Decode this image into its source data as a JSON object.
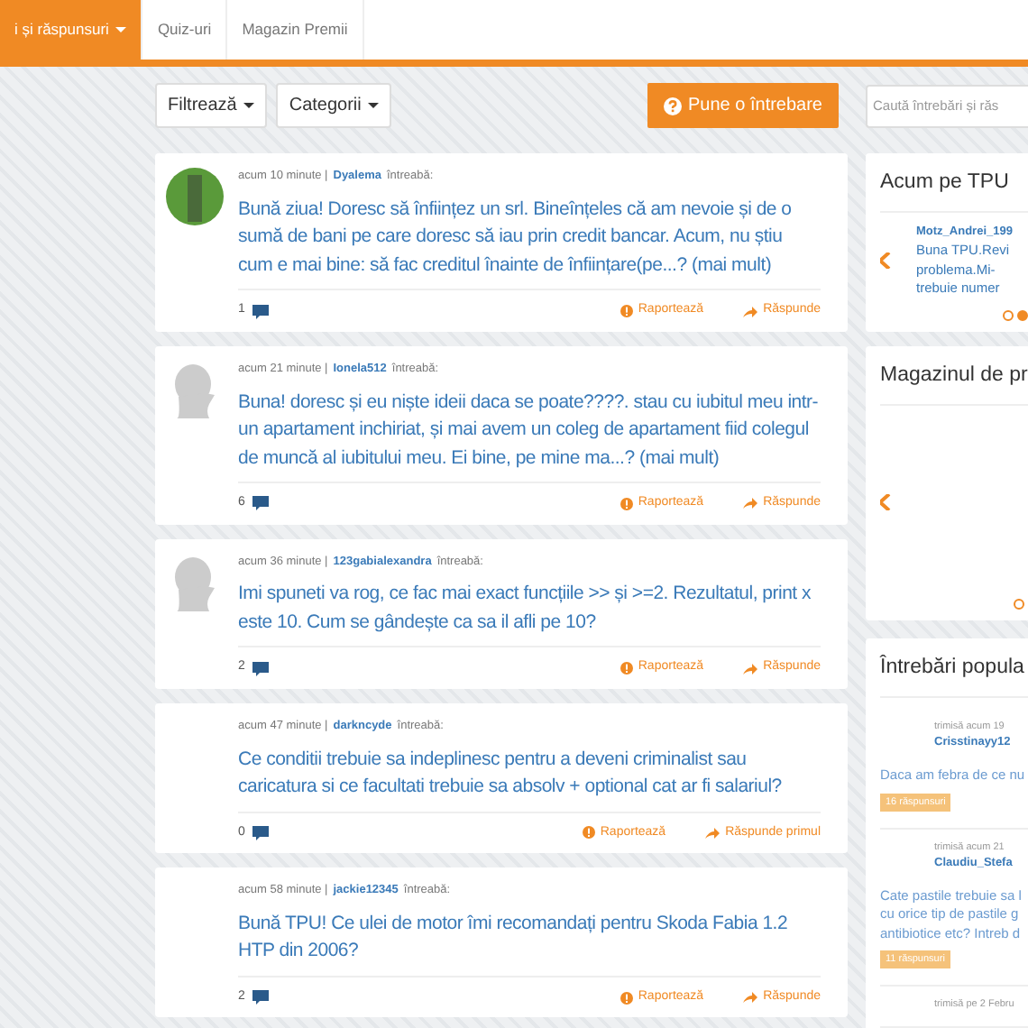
{
  "nav": {
    "items": [
      {
        "label": "i și răspunsuri",
        "selected": true,
        "dropdown": true
      },
      {
        "label": "Quiz-uri",
        "selected": false,
        "dropdown": false
      },
      {
        "label": "Magazin Premii",
        "selected": false,
        "dropdown": false
      }
    ]
  },
  "toolbar": {
    "filters": [
      "Filtrează",
      "Categorii"
    ],
    "ask_button": "Pune o întrebare",
    "search": {
      "placeholder": "Caută întrebări și răs"
    }
  },
  "questions": [
    {
      "kind": "photo",
      "time": "acum 10 minute |",
      "author": "Dyalema",
      "verb": "întreabă:",
      "text": "Bună ziua! Doresc să înființez un srl. Bineînțeles că am nevoie și de o sumă de bani pe care doresc să iau prin credit bancar. Acum, nu știu cum e mai bine: să fac creditul înainte de înființare(pe...? (mai mult)",
      "answers": "1",
      "report": "Raportează",
      "reply": "Răspunde"
    },
    {
      "kind": "silhouette",
      "time": "acum 21 minute |",
      "author": "Ionela512",
      "verb": "întreabă:",
      "text": "Buna! doresc și eu niște ideii daca se poate????. stau cu iubitul meu intr-un apartament inchiriat, și mai avem un coleg de apartament fiid colegul de muncă al iubitului meu. Ei bine, pe mine ma...? (mai mult)",
      "answers": "6",
      "report": "Raportează",
      "reply": "Răspunde"
    },
    {
      "kind": "silhouette",
      "time": "acum 36 minute |",
      "author": "123gabialexandra",
      "verb": "întreabă:",
      "text": "Imi spuneti va rog, ce fac mai exact funcțiile >> și >=2. Rezultatul, print x este 10. Cum se gândește ca sa il afli pe 10?",
      "answers": "2",
      "report": "Raportează",
      "reply": "Răspunde"
    },
    {
      "kind": "plain",
      "time": "acum 47 minute |",
      "author": "darkncyde",
      "verb": "întreabă:",
      "text": "Ce conditii trebuie sa indeplinesc pentru a deveni criminalist sau caricatura si ce facultati trebuie sa absolv + optional cat ar fi salariul?",
      "answers": "0",
      "report": "Raportează",
      "reply": "Răspunde primul"
    },
    {
      "kind": "plain",
      "time": "acum 58 minute |",
      "author": "jackie12345",
      "verb": "întreabă:",
      "text": "Bună TPU! Ce ulei de motor îmi recomandați pentru Skoda Fabia 1.2 HTP din 2006?",
      "answers": "2",
      "report": "Raportează",
      "reply": "Răspunde"
    }
  ],
  "sidebar": {
    "now": {
      "title": "Acum pe TPU",
      "author": "Motz_Andrei_199",
      "lines": [
        "Buna TPU.Revi",
        "problema.Mi-",
        "trebuie numer"
      ],
      "dots": [
        {
          "selected": false
        },
        {
          "selected": true
        }
      ]
    },
    "shop": {
      "title": "Magazinul de pr",
      "dots": [
        {
          "selected": false
        }
      ]
    },
    "popular": {
      "title": "Întrebări popula",
      "items": [
        {
          "meta": "trimisă acum 19",
          "author": "Crisstinayy12",
          "lines": [
            "Daca am febra de ce nu"
          ],
          "badge": "16 răspunsuri"
        },
        {
          "meta": "trimisă acum 21",
          "author": "Claudiu_Stefa",
          "lines": [
            "Cate pastile trebuie sa l",
            "cu orice tip de pastile g",
            "antibiotice etc? Intreb d"
          ],
          "badge": "11 răspunsuri"
        },
        {
          "meta": "trimisă pe 2 Febru"
        }
      ]
    }
  }
}
